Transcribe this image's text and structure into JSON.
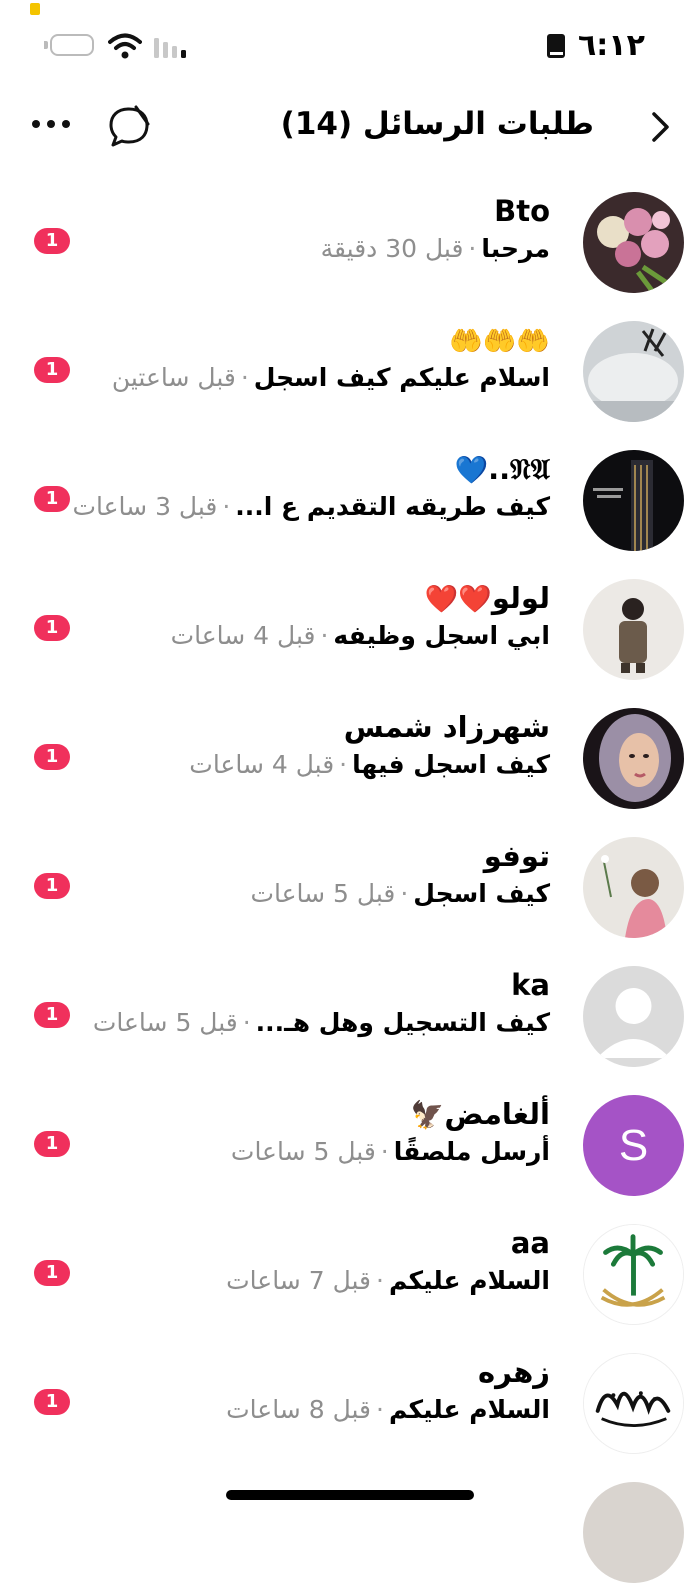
{
  "status_bar": {
    "time": "٦:١٢"
  },
  "header": {
    "title": "طلبات الرسائل (14)"
  },
  "requests": [
    {
      "name": "Bto",
      "message": "مرحبا",
      "time": "قبل 30 دقيقة",
      "badge": "1"
    },
    {
      "name": "",
      "name_emoji": "🤲🤲🤲",
      "message": "اسلام عليكم كيف اسجل",
      "time": "قبل ساعتين",
      "badge": "1"
    },
    {
      "name": "𝔑𝔄..",
      "name_emoji": "💙",
      "message": "كيف طريقه التقديم ع ا...",
      "time": "قبل 3 ساعات",
      "badge": "1"
    },
    {
      "name": "لولو",
      "name_emoji": "❤️❤️",
      "message": "ابي اسجل وظيفه",
      "time": "قبل 4 ساعات",
      "badge": "1"
    },
    {
      "name": "شهرزاد شمس",
      "message": "كيف اسجل فيها",
      "time": "قبل 4 ساعات",
      "badge": "1"
    },
    {
      "name": "توفو",
      "message": "كيف اسجل",
      "time": "قبل 5 ساعات",
      "badge": "1"
    },
    {
      "name": "ka",
      "message": "كيف التسجيل وهل هـ...",
      "time": "قبل 5 ساعات",
      "badge": "1"
    },
    {
      "name": "ألغامض",
      "name_emoji": "🦅",
      "message": "أرسل ملصقًا",
      "time": "قبل 5 ساعات",
      "badge": "1",
      "avatar_letter": "S"
    },
    {
      "name": "aa",
      "message": "السلام عليكم",
      "time": "قبل 7 ساعات",
      "badge": "1"
    },
    {
      "name": "زهره",
      "message": "السلام عليكم",
      "time": "قبل 8 ساعات",
      "badge": "1"
    }
  ],
  "colors": {
    "badge": "#f0305c",
    "secondary_text": "#8e8e8e",
    "letter_avatar": "#a553c6"
  }
}
